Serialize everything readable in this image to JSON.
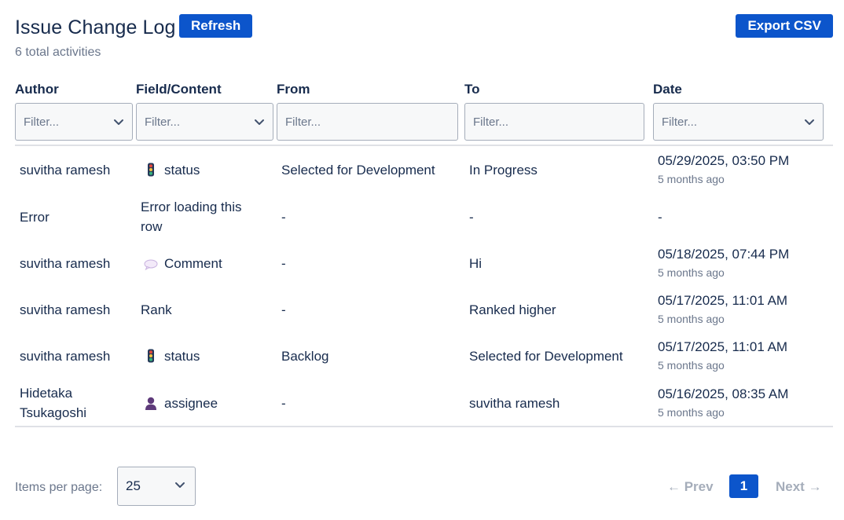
{
  "header": {
    "title": "Issue Change Log",
    "refresh_label": "Refresh",
    "export_label": "Export CSV",
    "subtitle": "6 total activities"
  },
  "columns": [
    {
      "label": "Author",
      "placeholder": "Filter...",
      "has_dropdown": true
    },
    {
      "label": "Field/Content",
      "placeholder": "Filter...",
      "has_dropdown": true
    },
    {
      "label": "From",
      "placeholder": "Filter...",
      "has_dropdown": false
    },
    {
      "label": "To",
      "placeholder": "Filter...",
      "has_dropdown": false
    },
    {
      "label": "Date",
      "placeholder": "Filter...",
      "has_dropdown": true
    }
  ],
  "rows": [
    {
      "author": "suvitha ramesh",
      "field": "status",
      "field_icon": "traffic-light-icon",
      "from": "Selected for Development",
      "to": "In Progress",
      "date": "05/29/2025, 03:50 PM",
      "ago": "5 months ago"
    },
    {
      "author": "Error",
      "field": "Error loading this row",
      "field_icon": "",
      "from": "-",
      "to": "-",
      "date": "-",
      "ago": ""
    },
    {
      "author": "suvitha ramesh",
      "field": "Comment",
      "field_icon": "speech-bubble-icon",
      "from": "-",
      "to": "Hi",
      "date": "05/18/2025, 07:44 PM",
      "ago": "5 months ago"
    },
    {
      "author": "suvitha ramesh",
      "field": "Rank",
      "field_icon": "",
      "from": "-",
      "to": "Ranked higher",
      "date": "05/17/2025, 11:01 AM",
      "ago": "5 months ago"
    },
    {
      "author": "suvitha ramesh",
      "field": "status",
      "field_icon": "traffic-light-icon",
      "from": "Backlog",
      "to": "Selected for Development",
      "date": "05/17/2025, 11:01 AM",
      "ago": "5 months ago"
    },
    {
      "author": "Hidetaka Tsukagoshi",
      "field": "assignee",
      "field_icon": "person-icon",
      "from": "-",
      "to": "suvitha ramesh",
      "date": "05/16/2025, 08:35 AM",
      "ago": "5 months ago"
    }
  ],
  "footer": {
    "items_per_page_label": "Items per page:",
    "items_per_page_value": "25",
    "prev_label": "← Prev",
    "current_page": "1",
    "next_label": "Next →"
  },
  "colors": {
    "accent": "#0c55cb",
    "text": "#172b4d",
    "muted": "#6b778c",
    "border": "#a5adba"
  }
}
